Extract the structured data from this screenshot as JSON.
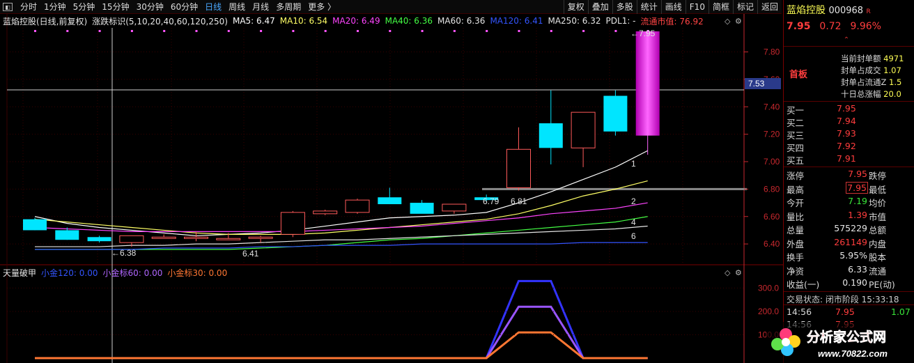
{
  "toolbar": {
    "periods": [
      "分时",
      "1分钟",
      "5分钟",
      "15分钟",
      "30分钟",
      "60分钟",
      "日线",
      "周线",
      "月线",
      "多周期",
      "更多 〉"
    ],
    "active_period": "日线",
    "buttons": [
      "复权",
      "叠加",
      "多股",
      "统计",
      "画线",
      "F10",
      "简框",
      "标记",
      "返回"
    ]
  },
  "header": {
    "stock_title": "蓝焰控股(日线,前复权)",
    "indicator_name": "涨跌标识(5,10,20,40,60,120,250)",
    "ma5": "MA5: 6.47",
    "ma10": "MA10: 6.54",
    "ma20": "MA20: 6.49",
    "ma40": "MA40: 6.36",
    "ma60": "MA60: 6.36",
    "ma120": "MA120: 6.41",
    "ma250": "MA250: 6.32",
    "pdl": "PDL1: -",
    "float_cap": "流通市值: 76.92"
  },
  "sub_header": {
    "name": "天量破甲",
    "s1": "小金120: 0.00",
    "s2": "小金标60: 0.00",
    "s3": "小金标30: 0.00"
  },
  "colors": {
    "up": "#ff5a5a",
    "down": "#00e5ff",
    "ma5": "#ffffff",
    "ma10": "#ffff66",
    "ma20": "#ff44ff",
    "ma40": "#44ff44",
    "ma60": "#e6e6e6",
    "ma120": "#3355ff",
    "axis": "#c8282e",
    "grid": "#3a0000"
  },
  "chart_data": {
    "type": "candlestick",
    "y_axis_ticks": [
      "7.80",
      "7.60",
      "7.40",
      "7.20",
      "7.00",
      "6.80",
      "6.60",
      "6.40"
    ],
    "ylim": [
      6.36,
      7.95
    ],
    "candles": [
      {
        "o": 6.58,
        "h": 6.59,
        "l": 6.5,
        "c": 6.5
      },
      {
        "o": 6.5,
        "h": 6.52,
        "l": 6.43,
        "c": 6.43
      },
      {
        "o": 6.45,
        "h": 6.46,
        "l": 6.41,
        "c": 6.42
      },
      {
        "o": 6.41,
        "h": 6.46,
        "l": 6.38,
        "c": 6.46
      },
      {
        "o": 6.45,
        "h": 6.47,
        "l": 6.44,
        "c": 6.45
      },
      {
        "o": 6.45,
        "h": 6.49,
        "l": 6.42,
        "c": 6.45
      },
      {
        "o": 6.44,
        "h": 6.48,
        "l": 6.43,
        "c": 6.44
      },
      {
        "o": 6.44,
        "h": 6.46,
        "l": 6.41,
        "c": 6.45
      },
      {
        "o": 6.47,
        "h": 6.64,
        "l": 6.45,
        "c": 6.63
      },
      {
        "o": 6.62,
        "h": 6.65,
        "l": 6.61,
        "c": 6.64
      },
      {
        "o": 6.63,
        "h": 6.73,
        "l": 6.62,
        "c": 6.72
      },
      {
        "o": 6.74,
        "h": 6.81,
        "l": 6.69,
        "c": 6.69
      },
      {
        "o": 6.7,
        "h": 6.72,
        "l": 6.64,
        "c": 6.62
      },
      {
        "o": 6.64,
        "h": 6.69,
        "l": 6.62,
        "c": 6.69
      },
      {
        "o": 6.74,
        "h": 6.76,
        "l": 6.71,
        "c": 6.72
      },
      {
        "o": 6.81,
        "h": 7.25,
        "l": 6.79,
        "c": 7.09
      },
      {
        "o": 7.28,
        "h": 7.52,
        "l": 6.98,
        "c": 7.1
      },
      {
        "o": 7.1,
        "h": 7.36,
        "l": 6.96,
        "c": 7.36
      },
      {
        "o": 7.48,
        "h": 7.52,
        "l": 7.19,
        "c": 7.22
      },
      {
        "o": 7.19,
        "h": 7.95,
        "l": 7.05,
        "c": 7.95
      }
    ],
    "ma_lines": {
      "ma5": [
        6.6,
        6.55,
        6.52,
        6.5,
        6.48,
        6.46,
        6.47,
        6.48,
        6.5,
        6.53,
        6.56,
        6.59,
        6.6,
        6.61,
        6.63,
        6.7,
        6.78,
        6.87,
        6.96,
        7.08
      ],
      "ma10": [
        6.58,
        6.56,
        6.54,
        6.52,
        6.5,
        6.48,
        6.47,
        6.47,
        6.47,
        6.48,
        6.5,
        6.52,
        6.54,
        6.56,
        6.58,
        6.62,
        6.68,
        6.75,
        6.8,
        6.86
      ],
      "ma20": [
        6.52,
        6.51,
        6.5,
        6.49,
        6.49,
        6.49,
        6.49,
        6.49,
        6.49,
        6.5,
        6.51,
        6.52,
        6.53,
        6.55,
        6.57,
        6.59,
        6.62,
        6.64,
        6.66,
        6.7
      ],
      "ma40": [
        6.36,
        6.36,
        6.36,
        6.36,
        6.36,
        6.36,
        6.36,
        6.37,
        6.38,
        6.39,
        6.41,
        6.43,
        6.44,
        6.46,
        6.48,
        6.5,
        6.52,
        6.54,
        6.56,
        6.6
      ],
      "ma60": [
        6.38,
        6.38,
        6.38,
        6.39,
        6.39,
        6.4,
        6.4,
        6.41,
        6.42,
        6.43,
        6.43,
        6.44,
        6.45,
        6.46,
        6.47,
        6.48,
        6.49,
        6.5,
        6.51,
        6.53
      ],
      "ma120": [
        6.36,
        6.36,
        6.36,
        6.36,
        6.37,
        6.37,
        6.37,
        6.38,
        6.38,
        6.39,
        6.39,
        6.39,
        6.4,
        6.4,
        6.4,
        6.4,
        6.4,
        6.41,
        6.41,
        6.41
      ]
    },
    "line_labels": [
      "1",
      "2",
      "4",
      "6"
    ],
    "annotations": [
      "←6.38",
      "6.41",
      "6.79",
      "6.81",
      "←7.95"
    ],
    "crosshair_value": "7.53",
    "sub_axis_ticks": [
      "300.0",
      "200.0",
      "100.0"
    ],
    "sub_ylim": [
      0,
      340
    ],
    "sub_series": [
      {
        "values": [
          0,
          0,
          0,
          0,
          0,
          0,
          0,
          0,
          0,
          0,
          0,
          0,
          0,
          0,
          0,
          330,
          330,
          0,
          0,
          0
        ],
        "color": "#3333ff"
      },
      {
        "values": [
          0,
          0,
          0,
          0,
          0,
          0,
          0,
          0,
          0,
          0,
          0,
          0,
          0,
          0,
          0,
          220,
          220,
          0,
          0,
          0
        ],
        "color": "#9955ff"
      },
      {
        "values": [
          0,
          0,
          0,
          0,
          0,
          0,
          0,
          0,
          0,
          0,
          0,
          0,
          0,
          0,
          0,
          110,
          110,
          0,
          0,
          0
        ],
        "color": "#ff7733"
      }
    ]
  },
  "panel": {
    "name": "蓝焰控股",
    "code": "000968",
    "badge": "R",
    "price": "7.95",
    "change": "0.72",
    "pct": "9.96%",
    "board": "首板",
    "seal_amount_label": "当前封单额",
    "seal_amount": "4971",
    "seal_ratio_label": "封单占成交",
    "seal_ratio": "1.07",
    "seal_float_label": "封单占流通Z",
    "seal_float": "1.5",
    "ten_day_label": "十日总涨幅",
    "ten_day": "20.0",
    "bids": [
      {
        "label": "买一",
        "price": "7.95"
      },
      {
        "label": "买二",
        "price": "7.94"
      },
      {
        "label": "买三",
        "price": "7.93"
      },
      {
        "label": "买四",
        "price": "7.92"
      },
      {
        "label": "买五",
        "price": "7.91"
      }
    ],
    "stats": [
      {
        "l1": "涨停",
        "v1": "7.95",
        "l2": "跌停",
        "c": "red"
      },
      {
        "l1": "最高",
        "v1": "7.95",
        "l2": "最低",
        "c": "red"
      },
      {
        "l1": "今开",
        "v1": "7.19",
        "l2": "均价",
        "c": "green"
      },
      {
        "l1": "量比",
        "v1": "1.39",
        "l2": "市值",
        "c": "red"
      },
      {
        "l1": "总量",
        "v1": "575229",
        "l2": "总额",
        "c": "white"
      },
      {
        "l1": "外盘",
        "v1": "261149",
        "l2": "内盘",
        "c": "red"
      },
      {
        "l1": "换手",
        "v1": "5.95%",
        "l2": "股本",
        "c": "white"
      },
      {
        "l1": "净资",
        "v1": "6.33",
        "l2": "流通",
        "c": "white"
      },
      {
        "l1": "收益(一)",
        "v1": "0.190",
        "l2": "PE(动)",
        "c": "white"
      }
    ],
    "trade_status": "交易状态: 闭市阶段 15:33:18",
    "ticks": [
      {
        "time": "14:56",
        "price": "7.95",
        "vol": "1.07"
      },
      {
        "time": "14:56",
        "price": "7.95",
        "vol": ""
      }
    ]
  },
  "watermark": {
    "title": "分析家公式网",
    "url": "www.70822.com"
  }
}
